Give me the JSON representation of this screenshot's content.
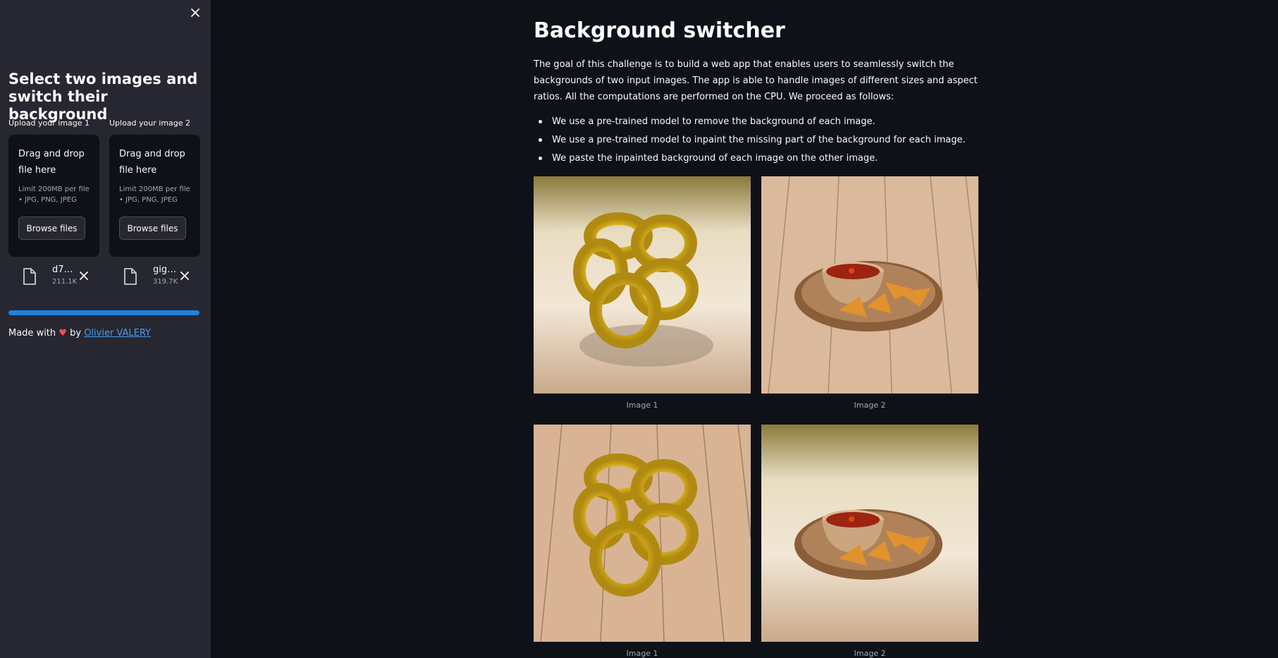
{
  "sidebar": {
    "title": "Select two images and switch their background",
    "uploader1": {
      "label": "Upload your image 1",
      "drop_title": "Drag and drop file here",
      "limit": "Limit 200MB per file • JPG, PNG, JPEG",
      "button": "Browse files",
      "file_name": "d7…",
      "file_size": "211.1K"
    },
    "uploader2": {
      "label": "Upload your image 2",
      "drop_title": "Drag and drop file here",
      "limit": "Limit 200MB per file • JPG, PNG, JPEG",
      "button": "Browse files",
      "file_name": "gig…",
      "file_size": "319.7K"
    },
    "progress": 1.0,
    "footer": {
      "made_with": "Made with",
      "by": "by",
      "author": "Olivier VALERY"
    }
  },
  "main": {
    "title": "Background switcher",
    "intro": "The goal of this challenge is to build a web app that enables users to seamlessly switch the backgrounds of two input images. The app is able to handle images of different sizes and aspect ratios. All the computations are performed on the CPU. We proceed as follows:",
    "bullets": [
      "We use a pre-trained model to remove the background of each image.",
      "We use a pre-trained model to inpaint the missing part of the background for each image.",
      "We paste the inpainted background of each image on the other image."
    ],
    "row1": [
      {
        "caption": "Image 1",
        "subject": "onion rings",
        "background": "light wall"
      },
      {
        "caption": "Image 2",
        "subject": "salsa with chips",
        "background": "wood planks"
      }
    ],
    "row2": [
      {
        "caption": "Image 1",
        "subject": "onion rings",
        "background": "wood planks"
      },
      {
        "caption": "Image 2",
        "subject": "salsa with chips",
        "background": "light wall"
      }
    ]
  },
  "colors": {
    "app_bg": "#0e1117",
    "sidebar_bg": "#262730",
    "accent": "#1c83e1",
    "link": "#4a9bf0",
    "heart": "#ff4b4b"
  },
  "icons": {
    "close": "close-icon",
    "file": "file-icon",
    "remove": "remove-file-icon"
  }
}
